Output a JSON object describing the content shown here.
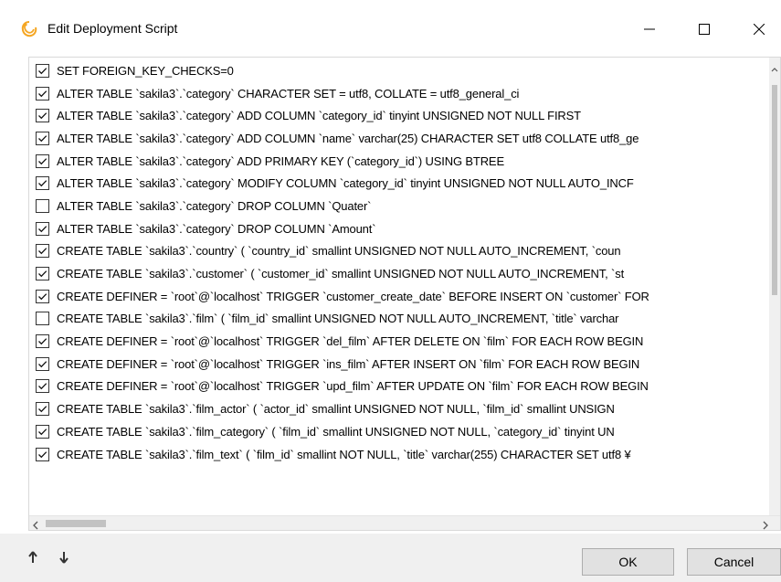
{
  "window": {
    "title": "Edit Deployment Script",
    "icon": "navicat-icon",
    "controls": [
      "minimize-icon",
      "maximize-icon",
      "close-icon"
    ]
  },
  "statements": [
    {
      "checked": true,
      "text": "SET FOREIGN_KEY_CHECKS=0"
    },
    {
      "checked": true,
      "text": "ALTER TABLE `sakila3`.`category` CHARACTER SET = utf8, COLLATE = utf8_general_ci"
    },
    {
      "checked": true,
      "text": "ALTER TABLE `sakila3`.`category` ADD COLUMN `category_id` tinyint UNSIGNED NOT NULL FIRST"
    },
    {
      "checked": true,
      "text": "ALTER TABLE `sakila3`.`category` ADD COLUMN `name` varchar(25) CHARACTER SET utf8 COLLATE utf8_ge"
    },
    {
      "checked": true,
      "text": "ALTER TABLE `sakila3`.`category` ADD PRIMARY KEY (`category_id`) USING BTREE"
    },
    {
      "checked": true,
      "text": "ALTER TABLE `sakila3`.`category` MODIFY COLUMN `category_id` tinyint UNSIGNED NOT NULL AUTO_INCF"
    },
    {
      "checked": false,
      "text": "ALTER TABLE `sakila3`.`category` DROP COLUMN `Quater`"
    },
    {
      "checked": true,
      "text": "ALTER TABLE `sakila3`.`category` DROP COLUMN `Amount`"
    },
    {
      "checked": true,
      "text": "CREATE TABLE `sakila3`.`country`  (  `country_id` smallint UNSIGNED NOT NULL AUTO_INCREMENT,  `coun"
    },
    {
      "checked": true,
      "text": "CREATE TABLE `sakila3`.`customer`  (  `customer_id` smallint UNSIGNED NOT NULL AUTO_INCREMENT,  `st"
    },
    {
      "checked": true,
      "text": "CREATE DEFINER = `root`@`localhost` TRIGGER `customer_create_date` BEFORE INSERT ON `customer` FOR"
    },
    {
      "checked": false,
      "text": "CREATE TABLE `sakila3`.`film`  (  `film_id` smallint UNSIGNED NOT NULL AUTO_INCREMENT,  `title` varchar"
    },
    {
      "checked": true,
      "text": "CREATE DEFINER = `root`@`localhost` TRIGGER `del_film` AFTER DELETE ON `film` FOR EACH ROW BEGIN"
    },
    {
      "checked": true,
      "text": "CREATE DEFINER = `root`@`localhost` TRIGGER `ins_film` AFTER INSERT ON `film` FOR EACH ROW BEGIN"
    },
    {
      "checked": true,
      "text": "CREATE DEFINER = `root`@`localhost` TRIGGER `upd_film` AFTER UPDATE ON `film` FOR EACH ROW BEGIN"
    },
    {
      "checked": true,
      "text": "CREATE TABLE `sakila3`.`film_actor`  (  `actor_id` smallint UNSIGNED NOT NULL,  `film_id` smallint UNSIGN"
    },
    {
      "checked": true,
      "text": "CREATE TABLE `sakila3`.`film_category`  (  `film_id` smallint UNSIGNED NOT NULL,  `category_id` tinyint UN"
    },
    {
      "checked": true,
      "text": "CREATE TABLE `sakila3`.`film_text`  (  `film_id` smallint NOT NULL,  `title` varchar(255) CHARACTER SET utf8 ¥"
    }
  ],
  "footer": {
    "move_up_icon": "arrow-up-icon",
    "move_down_icon": "arrow-down-icon",
    "ok_label": "OK",
    "cancel_label": "Cancel"
  },
  "colors": {
    "footer_bg": "#f0f0f0",
    "button_bg": "#e1e1e1",
    "icon_orange": "#f5a623"
  }
}
